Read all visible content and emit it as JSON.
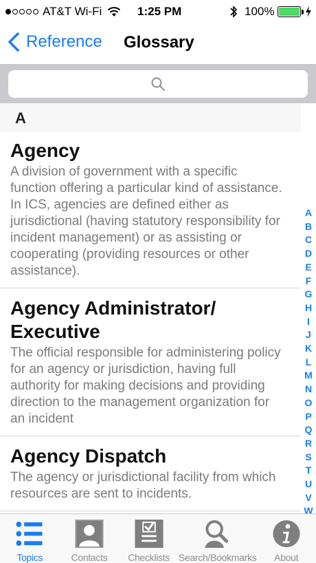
{
  "status_bar": {
    "carrier": "AT&T Wi-Fi",
    "time": "1:25 PM",
    "battery_percent": "100%",
    "battery_level": 1.0,
    "signal_bars_filled": 1,
    "signal_bars_total": 5
  },
  "nav": {
    "back_label": "Reference",
    "title": "Glossary"
  },
  "search": {
    "placeholder": ""
  },
  "section": {
    "letter": "A"
  },
  "terms": [
    {
      "title": "Agency",
      "definition": "A division of government with a specific function offering a particular kind of assistance. In ICS, agencies are defined either as jurisdictional (having statutory responsibility for incident management) or as assisting or cooperating (providing resources or other assistance)."
    },
    {
      "title": "Agency Administrator/ Executive",
      "definition": "The official responsible for administering policy for an agency or jurisdiction, having full authority for making decisions and providing direction to the management organization for an incident"
    },
    {
      "title": "Agency Dispatch",
      "definition": "The agency or jurisdictional facility from which resources are sent to incidents."
    }
  ],
  "index_letters": [
    "A",
    "B",
    "C",
    "D",
    "E",
    "F",
    "G",
    "H",
    "I",
    "J",
    "K",
    "L",
    "M",
    "N",
    "O",
    "P",
    "Q",
    "R",
    "S",
    "T",
    "U",
    "V",
    "W"
  ],
  "tabs": [
    {
      "label": "Topics",
      "icon": "topics-list-icon",
      "active": true
    },
    {
      "label": "Contacts",
      "icon": "contacts-person-icon",
      "active": false
    },
    {
      "label": "Checklists",
      "icon": "checklist-icon",
      "active": false
    },
    {
      "label": "Search/Bookmarks",
      "icon": "search-bookmarks-icon",
      "active": false
    },
    {
      "label": "About",
      "icon": "info-icon",
      "active": false
    }
  ],
  "colors": {
    "accent": "#1a7cf3",
    "battery": "#4cd964",
    "definition_text": "#7b7b7b",
    "tab_inactive": "#8e8e93"
  }
}
